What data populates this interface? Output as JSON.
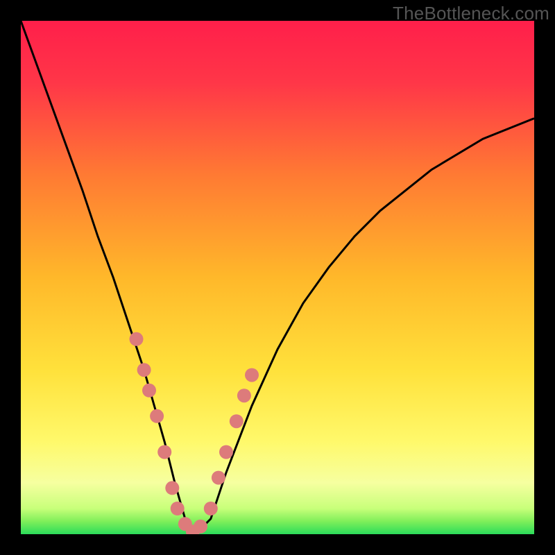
{
  "watermark": "TheBottleneck.com",
  "chart_data": {
    "type": "line",
    "title": "",
    "xlabel": "",
    "ylabel": "",
    "xlim": [
      0,
      100
    ],
    "ylim": [
      0,
      100
    ],
    "series": [
      {
        "name": "bottleneck-curve",
        "x": [
          0,
          4,
          8,
          12,
          15,
          18,
          21,
          24,
          26,
          28,
          30,
          32,
          34,
          37,
          40,
          45,
          50,
          55,
          60,
          65,
          70,
          80,
          90,
          100
        ],
        "y": [
          100,
          89,
          78,
          67,
          58,
          50,
          41,
          32,
          25,
          18,
          10,
          3,
          0,
          3,
          12,
          25,
          36,
          45,
          52,
          58,
          63,
          71,
          77,
          81
        ]
      }
    ],
    "markers": {
      "name": "highlight-dots",
      "x": [
        22.5,
        24,
        25,
        26.5,
        28,
        29.5,
        30.5,
        32,
        33.5,
        35,
        37,
        38.5,
        40,
        42,
        43.5,
        45
      ],
      "y": [
        38,
        32,
        28,
        23,
        16,
        9,
        5,
        2,
        0.5,
        1.5,
        5,
        11,
        16,
        22,
        27,
        31
      ]
    },
    "bands": [
      {
        "name": "green-band",
        "y0": 0,
        "y1": 4
      },
      {
        "name": "lime-band",
        "y0": 4,
        "y1": 15
      }
    ]
  },
  "colors": {
    "gradient_top": "#ff1f4a",
    "gradient_mid_upper": "#ff6a2a",
    "gradient_mid": "#ffd223",
    "gradient_lower": "#fff96b",
    "gradient_lime": "#b8ff5a",
    "gradient_green": "#2bdc5a",
    "curve": "#000000",
    "dot": "#dd7b7b",
    "frame": "#000000"
  }
}
